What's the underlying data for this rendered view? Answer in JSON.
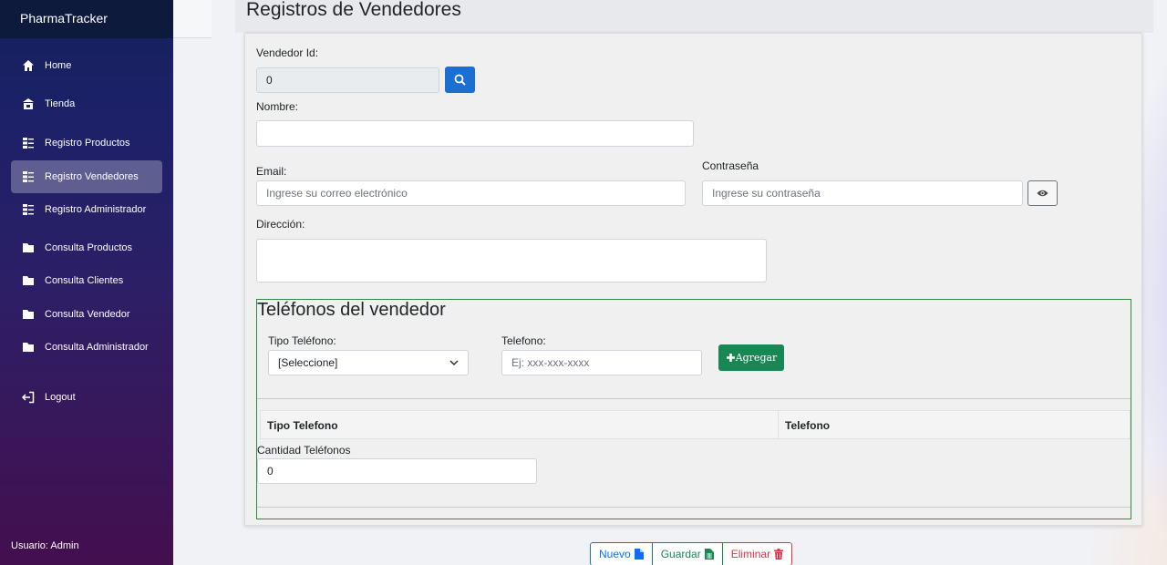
{
  "app": {
    "brand": "PharmaTracker"
  },
  "sidebar": {
    "items": [
      {
        "label": "Home",
        "icon": "home-icon"
      },
      {
        "label": "Tienda",
        "icon": "store-icon"
      },
      {
        "label": "Registro Productos",
        "icon": "list-icon"
      },
      {
        "label": "Registro Vendedores",
        "icon": "list-icon",
        "active": true
      },
      {
        "label": "Registro Administrador",
        "icon": "list-icon"
      },
      {
        "label": "Consulta Productos",
        "icon": "folder-icon"
      },
      {
        "label": "Consulta Clientes",
        "icon": "folder-icon"
      },
      {
        "label": "Consulta Vendedor",
        "icon": "folder-icon"
      },
      {
        "label": "Consulta Administrador",
        "icon": "folder-icon"
      },
      {
        "label": "Logout",
        "icon": "logout-icon"
      }
    ],
    "user_label": "Usuario: Admin"
  },
  "page": {
    "title": "Registros de Vendedores"
  },
  "form": {
    "vendedor_id_label": "Vendedor Id:",
    "vendedor_id_value": "0",
    "nombre_label": "Nombre:",
    "nombre_value": "",
    "email_label": "Email:",
    "email_placeholder": "Ingrese su correo electrónico",
    "password_label": "Contraseña",
    "password_placeholder": "Ingrese su contraseña",
    "direccion_label": "Dirección:",
    "direccion_value": ""
  },
  "phones": {
    "title": "Teléfonos del vendedor",
    "tipo_label": "Tipo Teléfono:",
    "tipo_selected": "[Seleccione]",
    "telefono_label": "Telefono:",
    "telefono_placeholder": "Ej: xxx-xxx-xxxx",
    "add_label": "Agregar",
    "table_headers": [
      "Tipo Telefono",
      "Telefono"
    ],
    "cantidad_label": "Cantidad Teléfonos",
    "cantidad_value": "0"
  },
  "actions": {
    "nuevo_label": "Nuevo",
    "guardar_label": "Guardar",
    "eliminar_label": "Eliminar"
  },
  "colors": {
    "primary": "#0d6efd",
    "success": "#198754",
    "danger": "#dc3545",
    "search_button": "#1a6fd1"
  }
}
